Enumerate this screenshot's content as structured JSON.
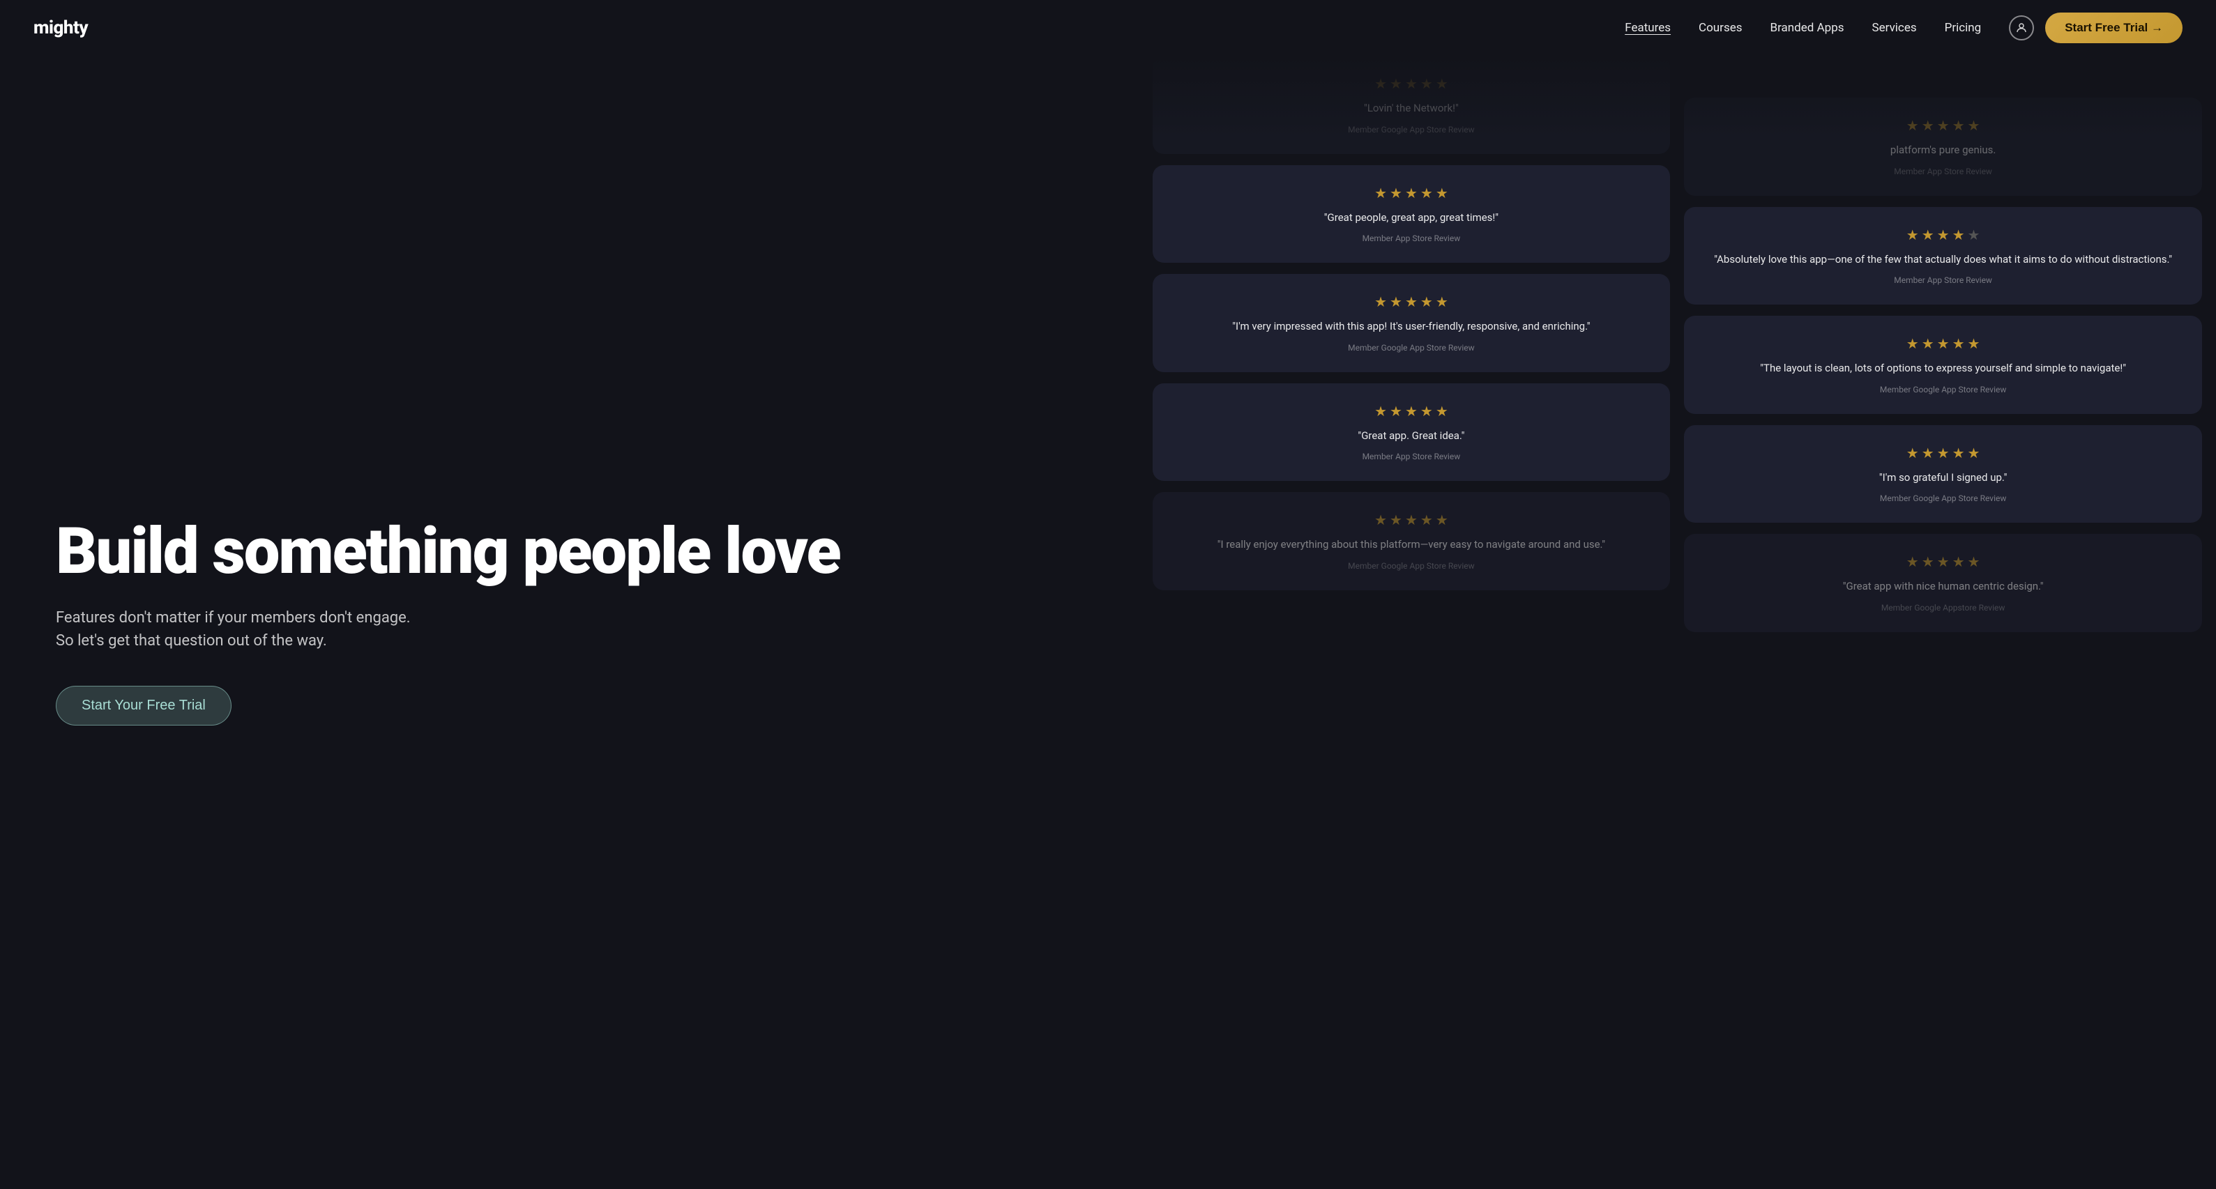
{
  "brand": {
    "logo": "mighty"
  },
  "nav": {
    "links": [
      {
        "label": "Features",
        "active": true
      },
      {
        "label": "Courses",
        "active": false
      },
      {
        "label": "Branded Apps",
        "active": false
      },
      {
        "label": "Services",
        "active": false
      },
      {
        "label": "Pricing",
        "active": false
      }
    ],
    "cta_label": "Start Free Trial →"
  },
  "hero": {
    "title": "Build something people love",
    "subtitle": "Features don't matter if your members don't engage. So let's get that question out of the way.",
    "cta_label": "Start Your Free Trial"
  },
  "reviews_left": [
    {
      "stars": 5,
      "text": "\"Lovin' the Network!\"",
      "source": "Member Google App Store Review",
      "faded": "top"
    },
    {
      "stars": 5,
      "text": "\"Great people, great app, great times!\"",
      "source": "Member App Store Review",
      "faded": ""
    },
    {
      "stars": 5,
      "text": "\"I'm very impressed with this app! It's user-friendly, responsive, and enriching.\"",
      "source": "Member Google App Store Review",
      "faded": ""
    },
    {
      "stars": 5,
      "text": "\"Great app. Great idea.\"",
      "source": "Member App Store Review",
      "faded": ""
    },
    {
      "stars": 5,
      "text": "\"I really enjoy everything about this platform—very easy to navigate around and use.\"",
      "source": "Member Google App Store Review",
      "faded": "bottom"
    }
  ],
  "reviews_right": [
    {
      "stars": 5,
      "text": "platform's pure genius.",
      "source": "Member App Store Review",
      "faded": "top"
    },
    {
      "stars": 4,
      "text": "\"Absolutely love this app—one of the few that actually does what it aims to do without distractions.\"",
      "source": "Member App Store Review",
      "faded": ""
    },
    {
      "stars": 5,
      "text": "\"The layout is clean, lots of options to express yourself and simple to navigate!\"",
      "source": "Member Google App Store Review",
      "faded": ""
    },
    {
      "stars": 5,
      "text": "\"I'm so grateful I signed up.\"",
      "source": "Member Google App Store Review",
      "faded": ""
    },
    {
      "stars": 5,
      "text": "\"Great app with nice human centric design.\"",
      "source": "Member Google Appstore Review",
      "faded": "bottom"
    }
  ]
}
